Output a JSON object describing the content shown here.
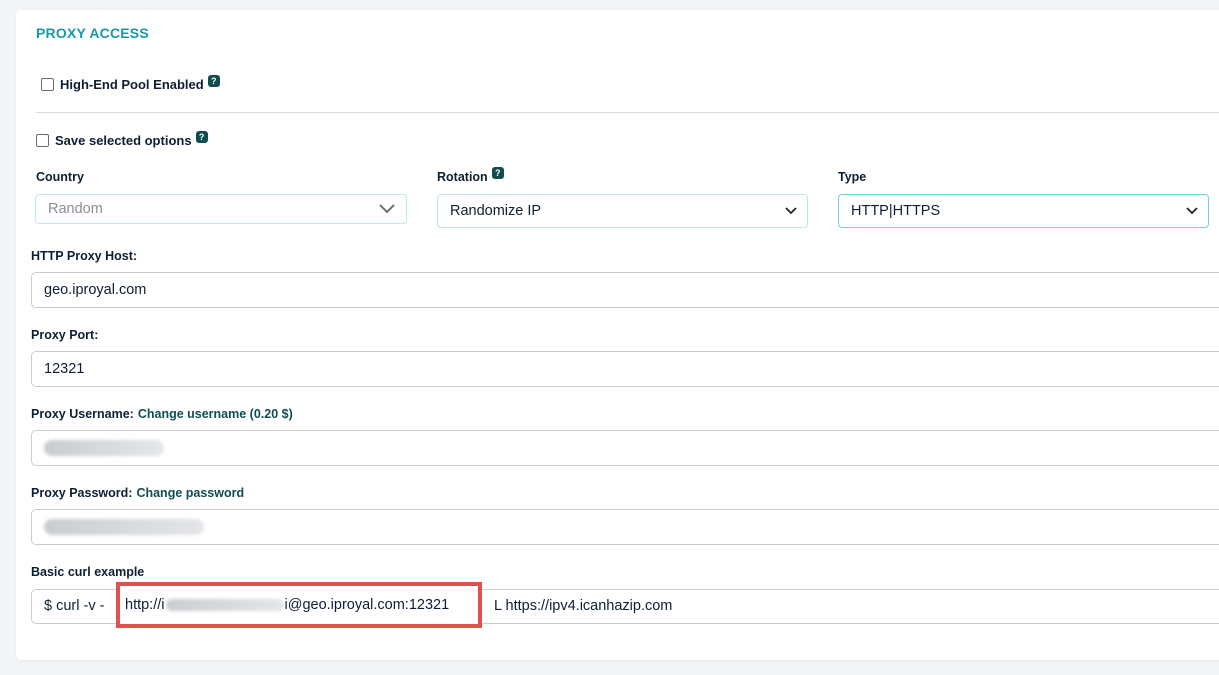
{
  "section_title": "PROXY ACCESS",
  "high_end_pool": {
    "label": "High-End Pool Enabled",
    "help": "?",
    "checked": false
  },
  "save_options": {
    "label": "Save selected options",
    "help": "?",
    "checked": false
  },
  "country": {
    "label": "Country",
    "value": "Random"
  },
  "rotation": {
    "label": "Rotation",
    "help": "?",
    "value": "Randomize IP"
  },
  "type": {
    "label": "Type",
    "value": "HTTP|HTTPS"
  },
  "host": {
    "label": "HTTP Proxy Host:",
    "value": "geo.iproyal.com"
  },
  "port": {
    "label": "Proxy Port:",
    "value": "12321"
  },
  "username": {
    "label": "Proxy Username:",
    "link": "Change username (0.20 $)"
  },
  "password": {
    "label": "Proxy Password:",
    "link": "Change password"
  },
  "curl": {
    "label": "Basic curl example",
    "prefix": "$ curl -v -",
    "url_start": "http://i",
    "url_end": "i@geo.iproyal.com:12321",
    "suffix": "L https://ipv4.icanhazip.com"
  },
  "colors": {
    "accent": "#1899a5",
    "highlight": "#e0504c",
    "badge": "#0f4d4f"
  }
}
